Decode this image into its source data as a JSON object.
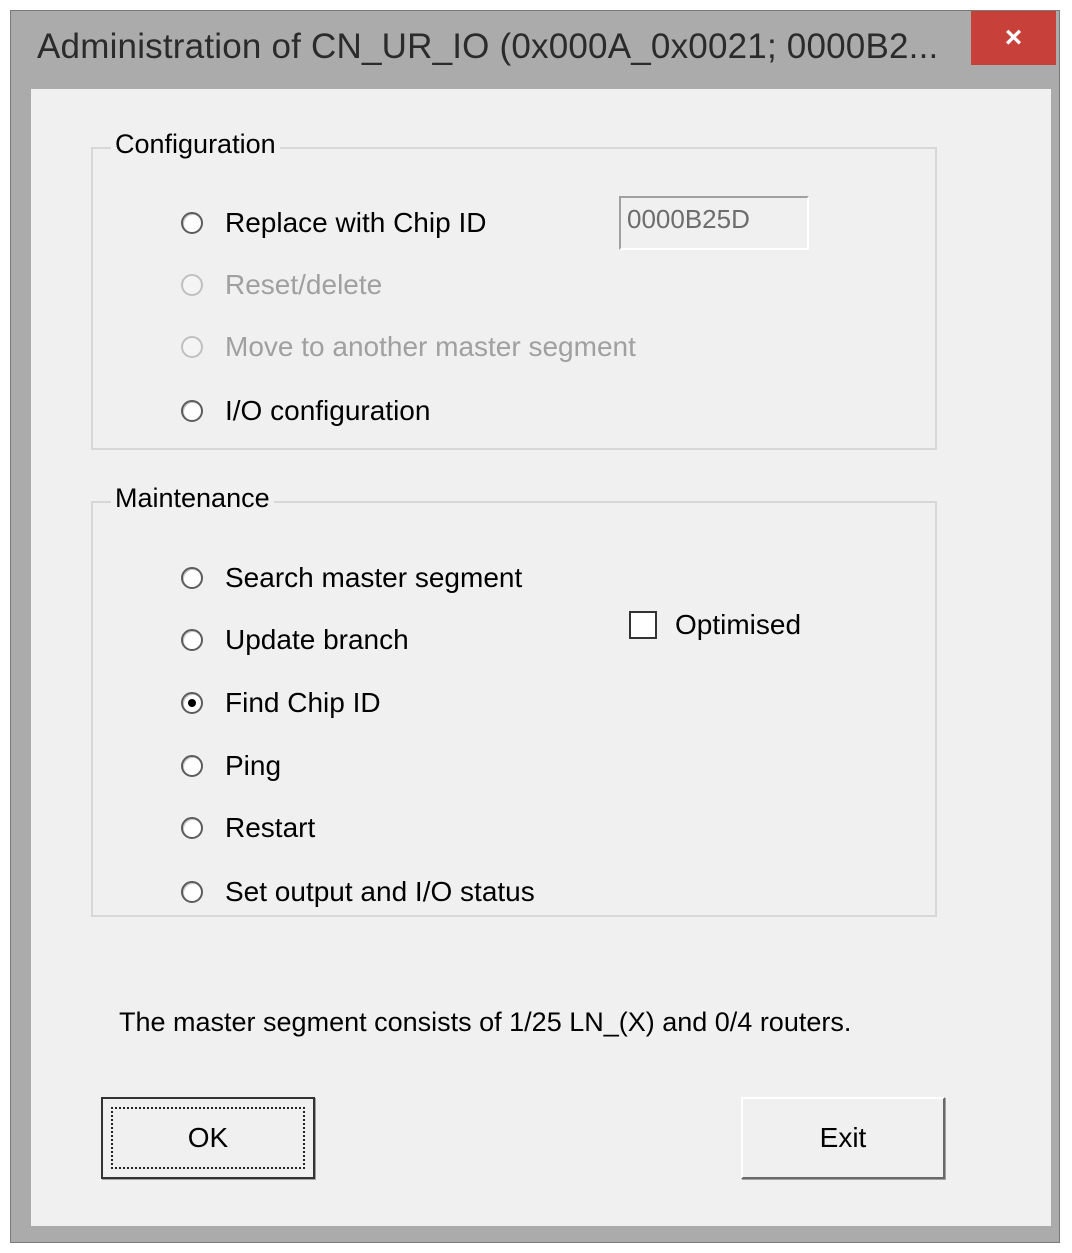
{
  "window": {
    "title": "Administration of CN_UR_IO (0x000A_0x0021; 0000B2...",
    "close_label": "×"
  },
  "configuration": {
    "legend": "Configuration",
    "options": [
      {
        "label": "Replace with Chip ID",
        "enabled": true,
        "checked": false
      },
      {
        "label": "Reset/delete",
        "enabled": false,
        "checked": false
      },
      {
        "label": "Move to another master segment",
        "enabled": false,
        "checked": false
      },
      {
        "label": "I/O configuration",
        "enabled": true,
        "checked": false
      }
    ],
    "chip_id_value": "0000B25D"
  },
  "maintenance": {
    "legend": "Maintenance",
    "options": [
      {
        "label": "Search master segment",
        "checked": false
      },
      {
        "label": "Update branch",
        "checked": false
      },
      {
        "label": "Find Chip ID",
        "checked": true
      },
      {
        "label": "Ping",
        "checked": false
      },
      {
        "label": "Restart",
        "checked": false
      },
      {
        "label": "Set output and I/O status",
        "checked": false
      }
    ],
    "optimised_label": "Optimised",
    "optimised_checked": false
  },
  "status_text": "The master segment consists of 1/25 LN_(X) and 0/4 routers.",
  "buttons": {
    "ok_label": "OK",
    "exit_label": "Exit"
  }
}
